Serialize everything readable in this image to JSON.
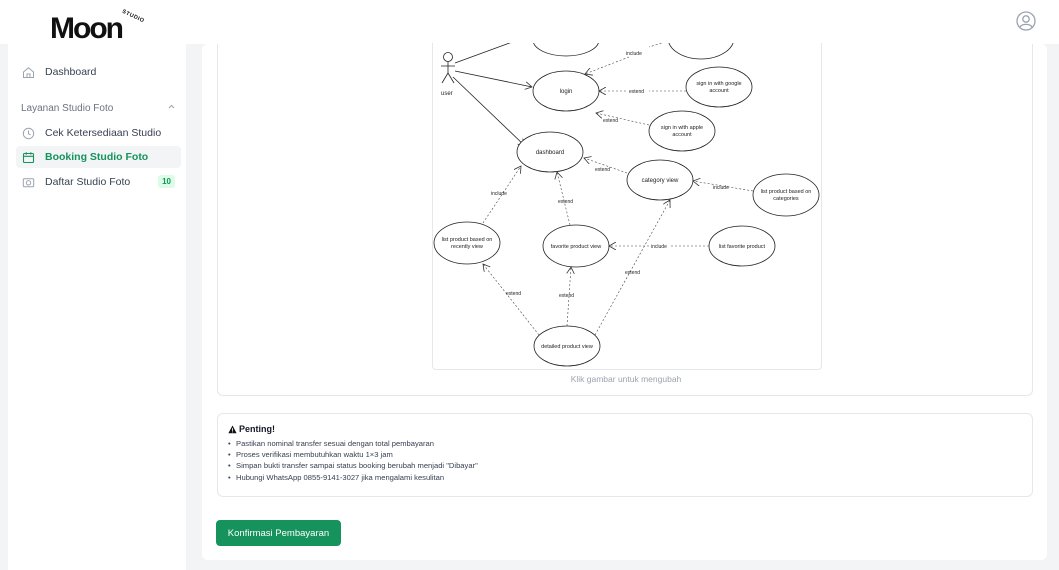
{
  "header": {
    "logo_text": "Moon",
    "logo_sub": "STUDIO"
  },
  "sidebar": {
    "dashboard_label": "Dashboard",
    "section_label": "Layanan Studio Foto",
    "items": [
      {
        "label": "Cek Ketersediaan Studio",
        "icon": "clock-icon"
      },
      {
        "label": "Booking Studio Foto",
        "icon": "calendar-icon",
        "active": true
      },
      {
        "label": "Daftar Studio Foto",
        "icon": "camera-icon",
        "badge": "10"
      }
    ]
  },
  "diagram": {
    "actor": "user",
    "nodes": {
      "login": "login",
      "google_1": "sign in with google",
      "google_2": "account",
      "apple_1": "sign in with apple",
      "apple_2": "account",
      "dashboard": "dashboard",
      "category": "category view",
      "list_cat_1": "list product based on",
      "list_cat_2": "categories",
      "recent_1": "list product based on",
      "recent_2": "recently view",
      "favorite": "favorite product view",
      "list_fav": "list favorite product",
      "detailed": "detailed product view"
    },
    "labels": {
      "include": "include",
      "extend": "extend"
    }
  },
  "caption": "Klik gambar untuk mengubah",
  "notice": {
    "title": "Penting!",
    "items": [
      "Pastikan nominal transfer sesuai dengan total pembayaran",
      "Proses verifikasi membutuhkan waktu 1×3 jam",
      "Simpan bukti transfer sampai status booking berubah menjadi \"Dibayar\"",
      "Hubungi WhatsApp 0855-9141-3027 jika mengalami kesulitan"
    ]
  },
  "confirm_button": "Konfirmasi Pembayaran",
  "colors": {
    "accent": "#16935d",
    "active_bg": "#f2f4f5",
    "page_bg": "#f3f4f6"
  }
}
